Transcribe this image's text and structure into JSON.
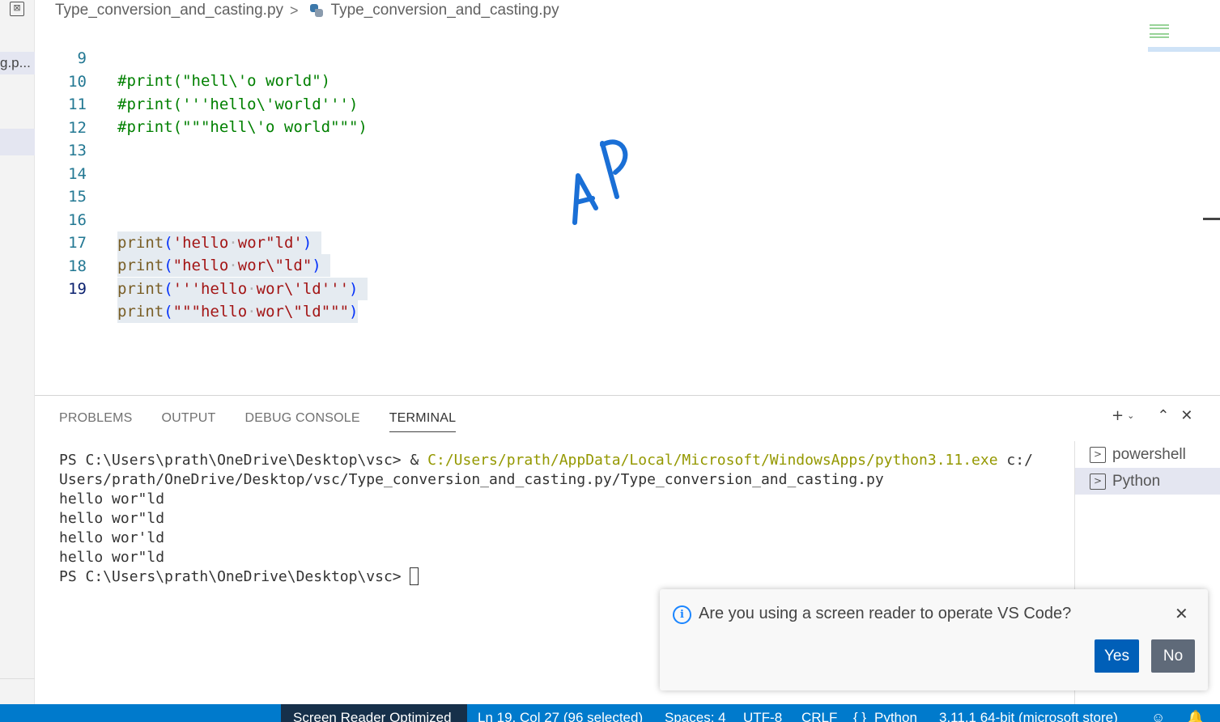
{
  "breadcrumb": {
    "folder": "Type_conversion_and_casting.py",
    "separator": ">",
    "file": "Type_conversion_and_casting.py"
  },
  "explorer": {
    "partial_file_label": "g.p..."
  },
  "editor": {
    "lines": [
      {
        "num": "9",
        "text": "#print(\"hell\\'o world\")"
      },
      {
        "num": "10",
        "text": "#print('''hello\\'world''')"
      },
      {
        "num": "11",
        "text": "#print(\"\"\"hell\\'o world\"\"\")"
      },
      {
        "num": "12",
        "text": ""
      },
      {
        "num": "13",
        "text": ""
      },
      {
        "num": "14",
        "text": ""
      },
      {
        "num": "15",
        "text": ""
      },
      {
        "num": "16",
        "fn": "print",
        "open": "(",
        "str1": "'hello",
        "str2": "wor\"ld'",
        "close": ")"
      },
      {
        "num": "17",
        "fn": "print",
        "open": "(",
        "str1": "\"hello",
        "str2": "wor\\\"ld\"",
        "close": ")"
      },
      {
        "num": "18",
        "fn": "print",
        "open": "(",
        "str1": "'''hello",
        "str2": "wor\\'ld'''",
        "close": ")"
      },
      {
        "num": "19",
        "fn": "print",
        "open": "(",
        "str1": "\"\"\"hello",
        "str2": "wor\\\"ld\"\"\"",
        "close": ")"
      }
    ]
  },
  "panel": {
    "tabs": [
      "PROBLEMS",
      "OUTPUT",
      "DEBUG CONSOLE",
      "TERMINAL"
    ],
    "active_tab": "TERMINAL",
    "terminal": {
      "cmd_prompt": "PS C:\\Users\\prath\\OneDrive\\Desktop\\vsc> & ",
      "cmd_exe": "C:/Users/prath/AppData/Local/Microsoft/WindowsApps/python3.11.exe",
      "cmd_arg1": " c:/",
      "cmd_arg2": "Users/prath/OneDrive/Desktop/vsc/Type_conversion_and_casting.py/Type_conversion_and_casting.py",
      "output": [
        "hello wor\"ld",
        "hello wor\"ld",
        "hello wor'ld",
        "hello wor\"ld"
      ],
      "final_prompt": "PS C:\\Users\\prath\\OneDrive\\Desktop\\vsc> "
    },
    "terminals": [
      "powershell",
      "Python"
    ]
  },
  "notification": {
    "message": "Are you using a screen reader to operate VS Code?",
    "yes": "Yes",
    "no": "No"
  },
  "statusbar": {
    "screen_reader": "Screen Reader Optimized",
    "position": "Ln 19, Col 27 (96 selected)",
    "spaces": "Spaces: 4",
    "encoding": "UTF-8",
    "eol": "CRLF",
    "language": "Python",
    "interpreter": "3.11.1 64-bit (microsoft store)"
  },
  "colors": {
    "statusbar_bg": "#007acc",
    "accent": "#005fb8",
    "comment": "#008000",
    "string": "#a31515",
    "function": "#795e26"
  }
}
